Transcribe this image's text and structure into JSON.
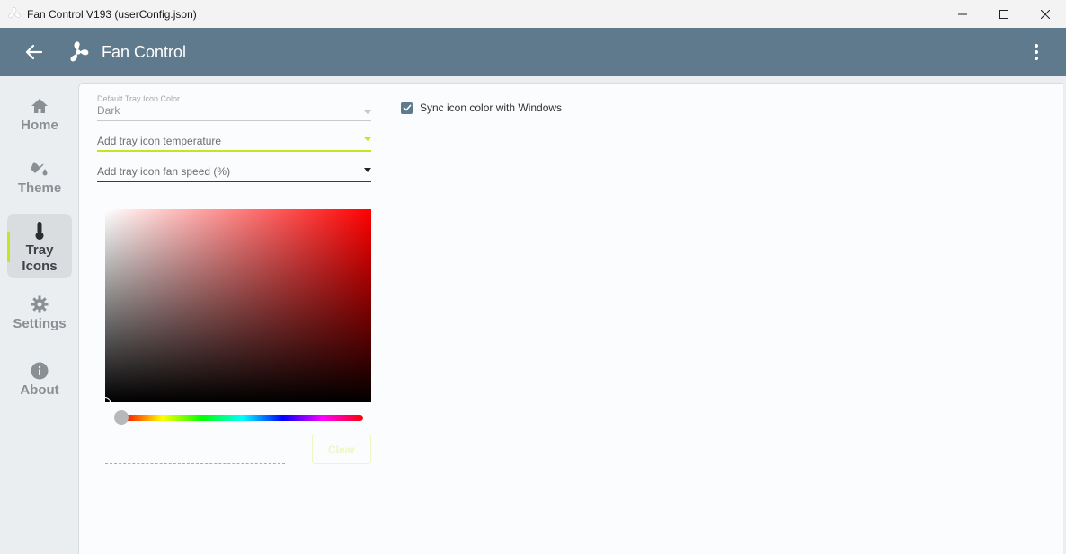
{
  "window": {
    "title": "Fan Control V193 (userConfig.json)"
  },
  "appbar": {
    "title": "Fan Control"
  },
  "sidebar": {
    "items": [
      {
        "label": "Home",
        "icon": "home-icon"
      },
      {
        "label": "Theme",
        "icon": "paint-bucket-icon"
      },
      {
        "label": "Tray Icons",
        "icon": "thermometer-icon",
        "active": true
      },
      {
        "label": "Settings",
        "icon": "gear-icon"
      },
      {
        "label": "About",
        "icon": "info-icon"
      }
    ]
  },
  "tray": {
    "default_color": {
      "label": "Default Tray Icon Color",
      "value": "Dark"
    },
    "add_temperature": {
      "placeholder": "Add tray icon temperature"
    },
    "add_fan_speed": {
      "placeholder": "Add tray icon fan speed (%)"
    },
    "color_picker": {
      "hue_color": "#ff0000",
      "hue_level": 0
    },
    "clear_label": "Clear",
    "sync_label": "Sync icon color with Windows",
    "sync_checked": true
  },
  "colors": {
    "appbar": "#5f7a8c",
    "accent": "#c5e51e"
  }
}
